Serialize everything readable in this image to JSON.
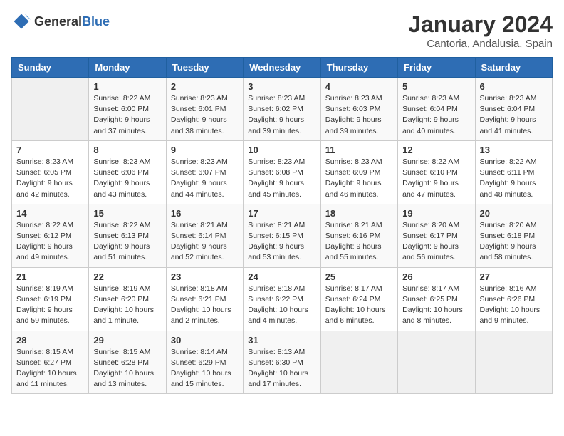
{
  "header": {
    "logo": {
      "text_general": "General",
      "text_blue": "Blue"
    },
    "month": "January 2024",
    "location": "Cantoria, Andalusia, Spain"
  },
  "weekdays": [
    "Sunday",
    "Monday",
    "Tuesday",
    "Wednesday",
    "Thursday",
    "Friday",
    "Saturday"
  ],
  "weeks": [
    [
      {
        "day": "",
        "info": ""
      },
      {
        "day": "1",
        "info": "Sunrise: 8:22 AM\nSunset: 6:00 PM\nDaylight: 9 hours\nand 37 minutes."
      },
      {
        "day": "2",
        "info": "Sunrise: 8:23 AM\nSunset: 6:01 PM\nDaylight: 9 hours\nand 38 minutes."
      },
      {
        "day": "3",
        "info": "Sunrise: 8:23 AM\nSunset: 6:02 PM\nDaylight: 9 hours\nand 39 minutes."
      },
      {
        "day": "4",
        "info": "Sunrise: 8:23 AM\nSunset: 6:03 PM\nDaylight: 9 hours\nand 39 minutes."
      },
      {
        "day": "5",
        "info": "Sunrise: 8:23 AM\nSunset: 6:04 PM\nDaylight: 9 hours\nand 40 minutes."
      },
      {
        "day": "6",
        "info": "Sunrise: 8:23 AM\nSunset: 6:04 PM\nDaylight: 9 hours\nand 41 minutes."
      }
    ],
    [
      {
        "day": "7",
        "info": "Sunrise: 8:23 AM\nSunset: 6:05 PM\nDaylight: 9 hours\nand 42 minutes."
      },
      {
        "day": "8",
        "info": "Sunrise: 8:23 AM\nSunset: 6:06 PM\nDaylight: 9 hours\nand 43 minutes."
      },
      {
        "day": "9",
        "info": "Sunrise: 8:23 AM\nSunset: 6:07 PM\nDaylight: 9 hours\nand 44 minutes."
      },
      {
        "day": "10",
        "info": "Sunrise: 8:23 AM\nSunset: 6:08 PM\nDaylight: 9 hours\nand 45 minutes."
      },
      {
        "day": "11",
        "info": "Sunrise: 8:23 AM\nSunset: 6:09 PM\nDaylight: 9 hours\nand 46 minutes."
      },
      {
        "day": "12",
        "info": "Sunrise: 8:22 AM\nSunset: 6:10 PM\nDaylight: 9 hours\nand 47 minutes."
      },
      {
        "day": "13",
        "info": "Sunrise: 8:22 AM\nSunset: 6:11 PM\nDaylight: 9 hours\nand 48 minutes."
      }
    ],
    [
      {
        "day": "14",
        "info": "Sunrise: 8:22 AM\nSunset: 6:12 PM\nDaylight: 9 hours\nand 49 minutes."
      },
      {
        "day": "15",
        "info": "Sunrise: 8:22 AM\nSunset: 6:13 PM\nDaylight: 9 hours\nand 51 minutes."
      },
      {
        "day": "16",
        "info": "Sunrise: 8:21 AM\nSunset: 6:14 PM\nDaylight: 9 hours\nand 52 minutes."
      },
      {
        "day": "17",
        "info": "Sunrise: 8:21 AM\nSunset: 6:15 PM\nDaylight: 9 hours\nand 53 minutes."
      },
      {
        "day": "18",
        "info": "Sunrise: 8:21 AM\nSunset: 6:16 PM\nDaylight: 9 hours\nand 55 minutes."
      },
      {
        "day": "19",
        "info": "Sunrise: 8:20 AM\nSunset: 6:17 PM\nDaylight: 9 hours\nand 56 minutes."
      },
      {
        "day": "20",
        "info": "Sunrise: 8:20 AM\nSunset: 6:18 PM\nDaylight: 9 hours\nand 58 minutes."
      }
    ],
    [
      {
        "day": "21",
        "info": "Sunrise: 8:19 AM\nSunset: 6:19 PM\nDaylight: 9 hours\nand 59 minutes."
      },
      {
        "day": "22",
        "info": "Sunrise: 8:19 AM\nSunset: 6:20 PM\nDaylight: 10 hours\nand 1 minute."
      },
      {
        "day": "23",
        "info": "Sunrise: 8:18 AM\nSunset: 6:21 PM\nDaylight: 10 hours\nand 2 minutes."
      },
      {
        "day": "24",
        "info": "Sunrise: 8:18 AM\nSunset: 6:22 PM\nDaylight: 10 hours\nand 4 minutes."
      },
      {
        "day": "25",
        "info": "Sunrise: 8:17 AM\nSunset: 6:24 PM\nDaylight: 10 hours\nand 6 minutes."
      },
      {
        "day": "26",
        "info": "Sunrise: 8:17 AM\nSunset: 6:25 PM\nDaylight: 10 hours\nand 8 minutes."
      },
      {
        "day": "27",
        "info": "Sunrise: 8:16 AM\nSunset: 6:26 PM\nDaylight: 10 hours\nand 9 minutes."
      }
    ],
    [
      {
        "day": "28",
        "info": "Sunrise: 8:15 AM\nSunset: 6:27 PM\nDaylight: 10 hours\nand 11 minutes."
      },
      {
        "day": "29",
        "info": "Sunrise: 8:15 AM\nSunset: 6:28 PM\nDaylight: 10 hours\nand 13 minutes."
      },
      {
        "day": "30",
        "info": "Sunrise: 8:14 AM\nSunset: 6:29 PM\nDaylight: 10 hours\nand 15 minutes."
      },
      {
        "day": "31",
        "info": "Sunrise: 8:13 AM\nSunset: 6:30 PM\nDaylight: 10 hours\nand 17 minutes."
      },
      {
        "day": "",
        "info": ""
      },
      {
        "day": "",
        "info": ""
      },
      {
        "day": "",
        "info": ""
      }
    ]
  ]
}
